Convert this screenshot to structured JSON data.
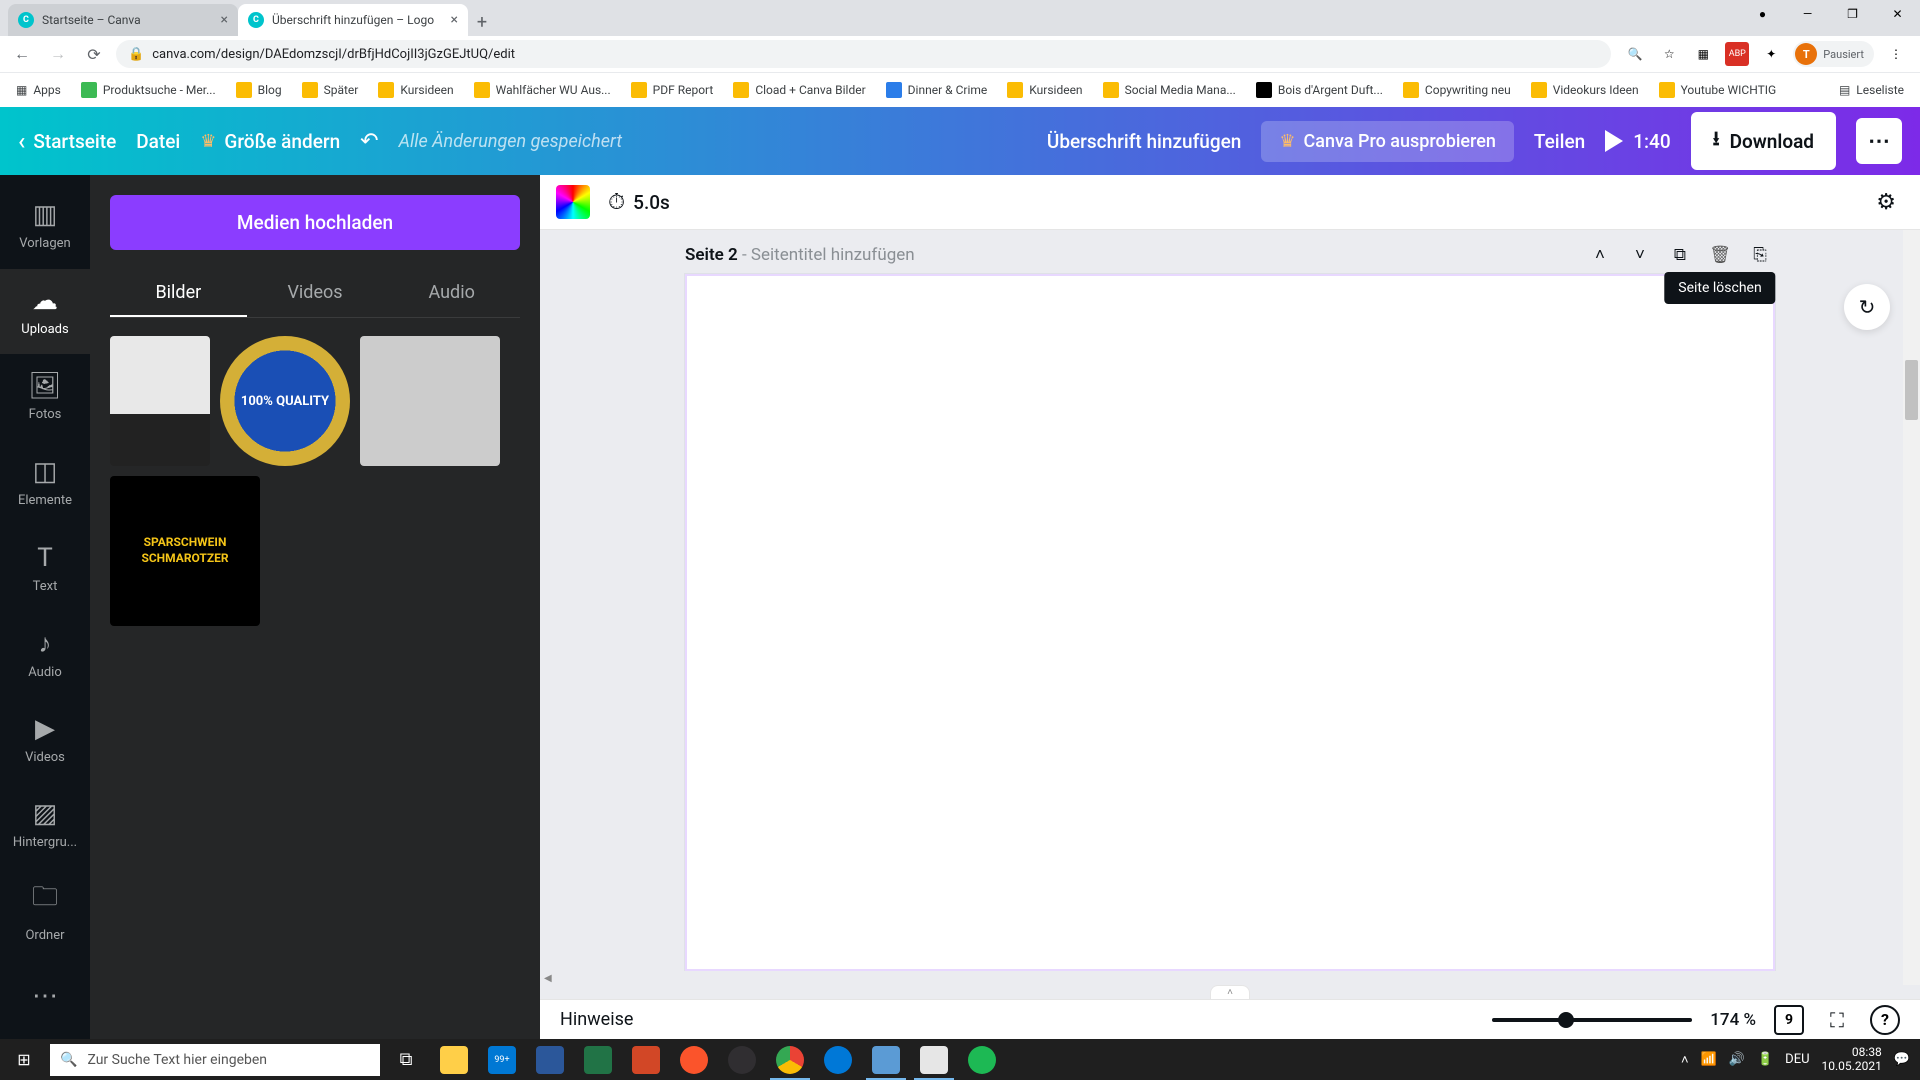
{
  "browser": {
    "tabs": [
      {
        "title": "Startseite – Canva"
      },
      {
        "title": "Überschrift hinzufügen – Logo"
      }
    ],
    "url": "canva.com/design/DAEdomzscjI/drBfjHdCojII3jGzGEJtUQ/edit",
    "avatar_label": "Pausiert",
    "bookmarks": [
      "Apps",
      "Produktsuche - Mer...",
      "Blog",
      "Später",
      "Kursideen",
      "Wahlfächer WU Aus...",
      "PDF Report",
      "Cload + Canva Bilder",
      "Dinner & Crime",
      "Kursideen",
      "Social Media Mana...",
      "Bois d'Argent Duft...",
      "Copywriting neu",
      "Videokurs Ideen",
      "Youtube WICHTIG"
    ],
    "bookmark_overflow": "Leseliste"
  },
  "canva": {
    "back": "Startseite",
    "file": "Datei",
    "resize": "Größe ändern",
    "saved": "Alle Änderungen gespeichert",
    "title": "Überschrift hinzufügen",
    "pro": "Canva Pro ausprobieren",
    "share": "Teilen",
    "play_time": "1:40",
    "download": "Download"
  },
  "rail": [
    "Vorlagen",
    "Uploads",
    "Fotos",
    "Elemente",
    "Text",
    "Audio",
    "Videos",
    "Hintergru...",
    "Ordner"
  ],
  "side": {
    "upload": "Medien hochladen",
    "tabs": [
      "Bilder",
      "Videos",
      "Audio"
    ],
    "thumb2_text": "100% QUALITY",
    "thumb4_text": "SPARSCHWEIN SCHMAROTZER"
  },
  "context": {
    "duration": "5.0s"
  },
  "page": {
    "label_prefix": "Seite 2",
    "label_sep": " - ",
    "label_placeholder": "Seitentitel hinzufügen",
    "tooltip_delete": "Seite löschen"
  },
  "footer": {
    "hinweise": "Hinweise",
    "zoom": "174 %",
    "page_count": "9"
  },
  "taskbar": {
    "search_placeholder": "Zur Suche Text hier eingeben",
    "lang": "DEU",
    "time": "08:38",
    "date": "10.05.2021",
    "badge": "99+"
  }
}
